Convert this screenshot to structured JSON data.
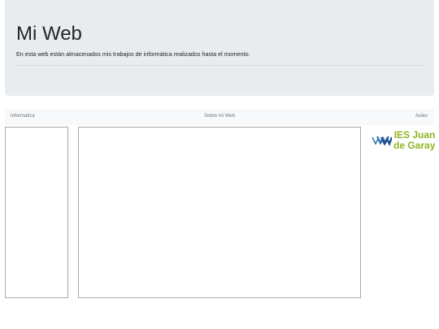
{
  "header": {
    "title": "Mi Web",
    "lead": "En esta web están almacenados mis trabajos de informática realizados hasta el momento."
  },
  "nav": {
    "left_label": "Informatica",
    "center_label": "Sobre mi Web",
    "right_label": "Aules"
  },
  "logo": {
    "line1": "IES Juan",
    "line2": "de Garay",
    "color": "#8fb31f",
    "mark_color": "#2a6db0"
  },
  "colors": {
    "jumbotron_bg": "#e9ecef",
    "nav_text": "#6c757d",
    "frame_border": "#a9a9a9"
  }
}
